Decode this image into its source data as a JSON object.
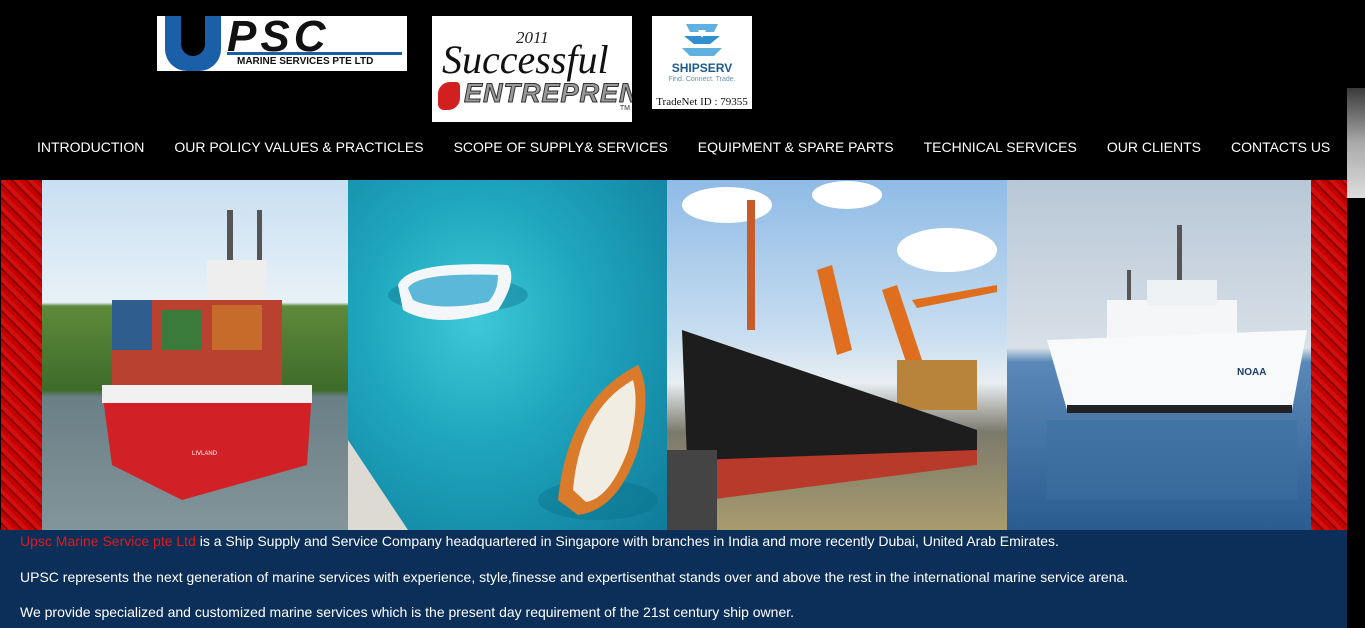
{
  "logos": {
    "upsc": {
      "main": "PSC",
      "sub": "MARINE SERVICES PTE LTD"
    },
    "entrepreneur": {
      "year": "2011",
      "line1": "Successful",
      "line2": "ENTREPRENEUR",
      "tm": "TM"
    },
    "shipserv": {
      "name": "SHIPSERV",
      "tagline": "Find. Connect. Trade.",
      "tradenet": "TradeNet ID : 79355"
    }
  },
  "nav": {
    "items": [
      "INTRODUCTION",
      "OUR POLICY VALUES & PRACTICLES",
      "SCOPE OF SUPPLY& SERVICES",
      "EQUIPMENT & SPARE PARTS",
      "TECHNICAL SERVICES",
      "OUR CLIENTS",
      "CONTACTS US"
    ]
  },
  "banner": {
    "ship1_name": "LIVLAND",
    "ship4_name": "NOAA"
  },
  "info": {
    "brand": "Upsc Marine Service pte Ltd",
    "line1_rest": " is a Ship Supply and Service Company headquartered in Singapore with branches in India and more recently Dubai, United Arab Emirates.",
    "line2": "UPSC represents the next generation of marine services with experience, style,finesse and expertisenthat stands over and above the rest in the international marine service arena.",
    "line3": "We provide specialized and customized marine services which is the present day requirement of the 21st century ship owner."
  },
  "colors": {
    "brand_red": "#e01b1b",
    "info_bg": "#0b2f58",
    "header_bg": "#000000"
  }
}
